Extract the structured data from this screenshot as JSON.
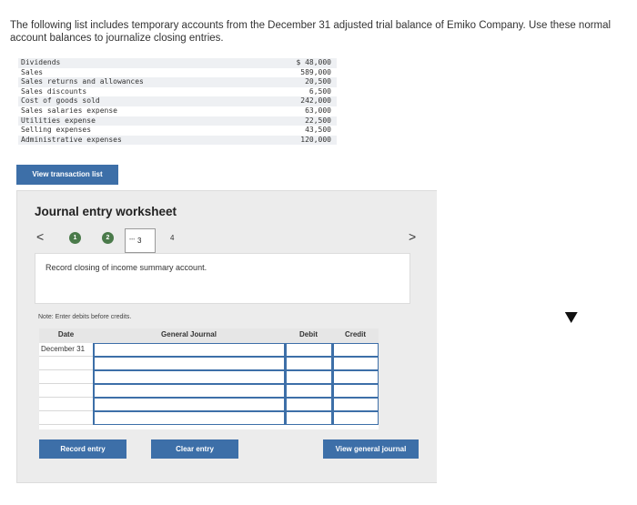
{
  "prompt": "The following list includes temporary accounts from the December 31 adjusted trial balance of Emiko Company. Use these normal account balances to journalize closing entries.",
  "accounts": [
    {
      "name": "Dividends",
      "amount": "$ 48,000"
    },
    {
      "name": "Sales",
      "amount": "589,000"
    },
    {
      "name": "Sales returns and allowances",
      "amount": "20,500"
    },
    {
      "name": "Sales discounts",
      "amount": "6,500"
    },
    {
      "name": "Cost of goods sold",
      "amount": "242,000"
    },
    {
      "name": "Sales salaries expense",
      "amount": "63,000"
    },
    {
      "name": "Utilities expense",
      "amount": "22,500"
    },
    {
      "name": "Selling expenses",
      "amount": "43,500"
    },
    {
      "name": "Administrative expenses",
      "amount": "120,000"
    }
  ],
  "view_transaction_label": "View transaction list",
  "worksheet": {
    "title": "Journal entry worksheet",
    "nav_prev": "<",
    "nav_next": ">",
    "steps": [
      "1",
      "2",
      "3",
      "4"
    ],
    "instruction": "Record closing of income summary account.",
    "note": "Note: Enter debits before credits."
  },
  "journal": {
    "headers": {
      "date": "Date",
      "general_journal": "General Journal",
      "debit": "Debit",
      "credit": "Credit"
    },
    "rows": [
      {
        "date": "December 31",
        "account": "",
        "debit": "",
        "credit": ""
      },
      {
        "date": "",
        "account": "",
        "debit": "",
        "credit": ""
      },
      {
        "date": "",
        "account": "",
        "debit": "",
        "credit": ""
      },
      {
        "date": "",
        "account": "",
        "debit": "",
        "credit": ""
      },
      {
        "date": "",
        "account": "",
        "debit": "",
        "credit": ""
      },
      {
        "date": "",
        "account": "",
        "debit": "",
        "credit": ""
      }
    ]
  },
  "buttons": {
    "record_entry": "Record entry",
    "clear_entry": "Clear entry",
    "view_general_journal": "View general journal"
  },
  "colors": {
    "button_blue": "#3d6fa8",
    "step_green": "#4a7a4a",
    "panel_gray": "#ececec"
  }
}
